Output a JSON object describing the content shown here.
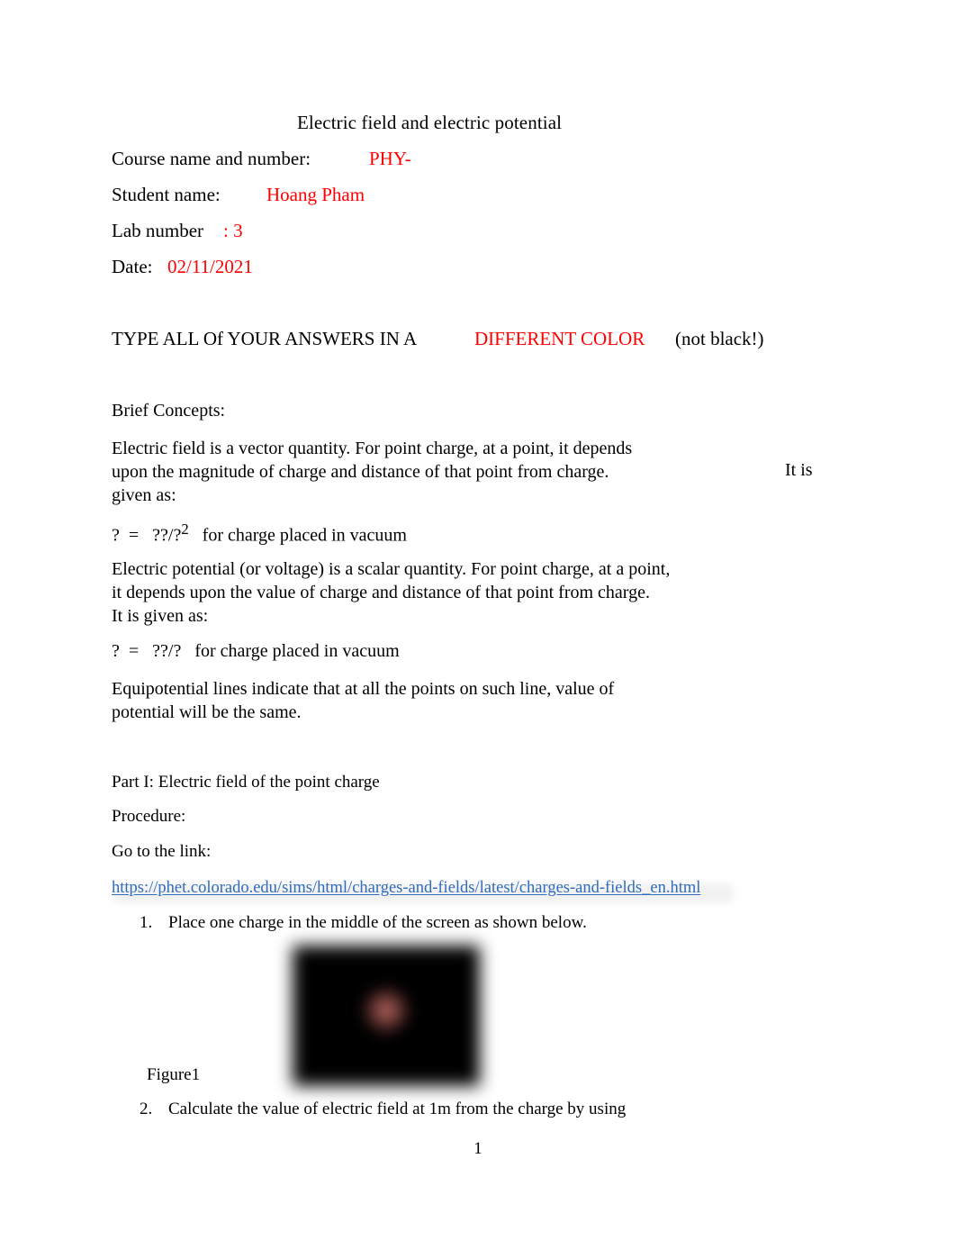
{
  "document": {
    "title": "Electric field and electric potential",
    "page_number": "1"
  },
  "header_fields": {
    "course_label": "Course name and number:",
    "course_value": "PHY-",
    "student_label": "Student name:",
    "student_value": "Hoang Pham",
    "lab_label": "Lab number",
    "lab_value": ": 3",
    "date_label": "Date:",
    "date_value": "02/11/2021"
  },
  "notice": {
    "lead": "TYPE ALL Of YOUR ANSWERS IN A",
    "highlight": "DIFFERENT COLOR",
    "tail": "(not black!)"
  },
  "concepts": {
    "heading": "Brief Concepts:",
    "efield_paragraph": "Electric field is a vector quantity. For point charge, at a point, it depends\nupon the magnitude of charge and distance of that point from charge.\ngiven as:",
    "efield_tail": "It is",
    "efield_formula_main": "?  =   ??/?",
    "efield_formula_sup": "2",
    "efield_formula_note": "for charge placed in vacuum",
    "epot_paragraph": "Electric potential (or voltage) is a scalar quantity. For point charge, at a point,\nit depends upon the value of charge and distance of that point from charge.\nIt is given as:",
    "epot_formula_main": "?  =   ??/?",
    "epot_formula_note": "for charge placed in vacuum",
    "equipotential_paragraph": "Equipotential lines indicate that at all the points on such line, value of\npotential will be the same."
  },
  "part_one": {
    "heading": "Part I: Electric field of the point charge",
    "procedure_heading": "Procedure:",
    "go_to_link_label": "Go to the link:",
    "link_text": "https://phet.colorado.edu/sims/html/charges-and-fields/latest/charges-and-fields_en.html",
    "steps": [
      {
        "number": "1.",
        "text": "Place one charge in the middle of the screen as shown below."
      },
      {
        "number": "2.",
        "text": "Calculate the value of electric field at 1m from the charge by using"
      }
    ],
    "figure_caption": "Figure1"
  },
  "colors": {
    "answer_red": "#ff0000",
    "link_blue": "#2f6cbd",
    "body_black": "#000000",
    "figure_background": "#000000",
    "charge_glow": "#ac605a"
  }
}
